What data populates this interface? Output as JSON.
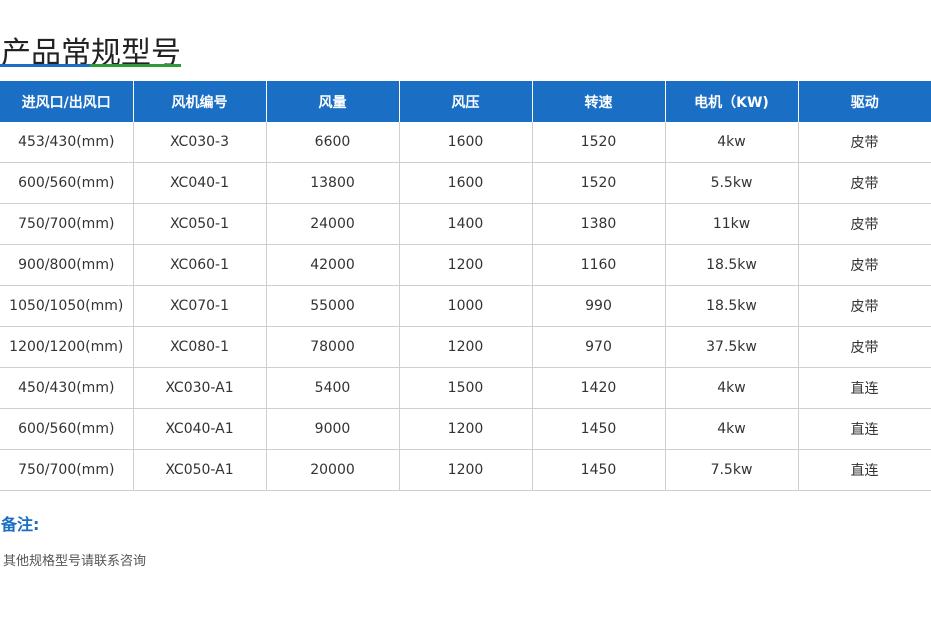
{
  "page": {
    "title": "产品常规型号",
    "underline_colors": [
      "#1a6fc4",
      "#2e9a3a"
    ]
  },
  "table": {
    "header_bg": "#1a6fc4",
    "columns": [
      "进风口/出风口",
      "风机编号",
      "风量",
      "风压",
      "转速",
      "电机（KW)",
      "驱动"
    ],
    "rows": [
      [
        "453/430(mm)",
        "XC030-3",
        "6600",
        "1600",
        "1520",
        "4kw",
        "皮带"
      ],
      [
        "600/560(mm)",
        "XC040-1",
        "13800",
        "1600",
        "1520",
        "5.5kw",
        "皮带"
      ],
      [
        "750/700(mm)",
        "XC050-1",
        "24000",
        "1400",
        "1380",
        "11kw",
        "皮带"
      ],
      [
        "900/800(mm)",
        "XC060-1",
        "42000",
        "1200",
        "1160",
        "18.5kw",
        "皮带"
      ],
      [
        "1050/1050(mm)",
        "XC070-1",
        "55000",
        "1000",
        "990",
        "18.5kw",
        "皮带"
      ],
      [
        "1200/1200(mm)",
        "XC080-1",
        "78000",
        "1200",
        "970",
        "37.5kw",
        "皮带"
      ],
      [
        "450/430(mm)",
        "XC030-A1",
        "5400",
        "1500",
        "1420",
        "4kw",
        "直连"
      ],
      [
        "600/560(mm)",
        "XC040-A1",
        "9000",
        "1200",
        "1450",
        "4kw",
        "直连"
      ],
      [
        "750/700(mm)",
        "XC050-A1",
        "20000",
        "1200",
        "1450",
        "7.5kw",
        "直连"
      ]
    ]
  },
  "notes": {
    "label": "备注:",
    "text": "其他规格型号请联系咨询"
  }
}
